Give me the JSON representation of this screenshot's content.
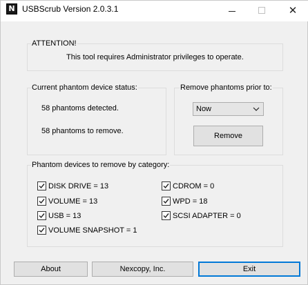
{
  "window": {
    "title": "USBScrub Version 2.0.3.1",
    "icon": "N"
  },
  "attention": {
    "label": "ATTENTION!",
    "message": "This tool requires Administrator privileges to operate."
  },
  "status": {
    "label": "Current phantom device status:",
    "detected": "58 phantoms detected.",
    "to_remove": "58 phantoms to remove."
  },
  "remove_prior": {
    "label": "Remove phantoms prior to:",
    "selected": "Now",
    "remove_button": "Remove"
  },
  "categories": {
    "label": "Phantom devices to remove by category:",
    "items": [
      {
        "label": "DISK DRIVE = 13",
        "checked": true
      },
      {
        "label": "VOLUME = 13",
        "checked": true
      },
      {
        "label": "USB = 13",
        "checked": true
      },
      {
        "label": "VOLUME SNAPSHOT = 1",
        "checked": true
      },
      {
        "label": "CDROM = 0",
        "checked": true
      },
      {
        "label": "WPD = 18",
        "checked": true
      },
      {
        "label": "SCSI ADAPTER = 0",
        "checked": true
      }
    ]
  },
  "footer": {
    "about": "About",
    "company": "Nexcopy, Inc.",
    "exit": "Exit"
  },
  "colors": {
    "window_bg": "#f0f0f0",
    "button_bg": "#e1e1e1",
    "focus_border": "#0078d7"
  }
}
